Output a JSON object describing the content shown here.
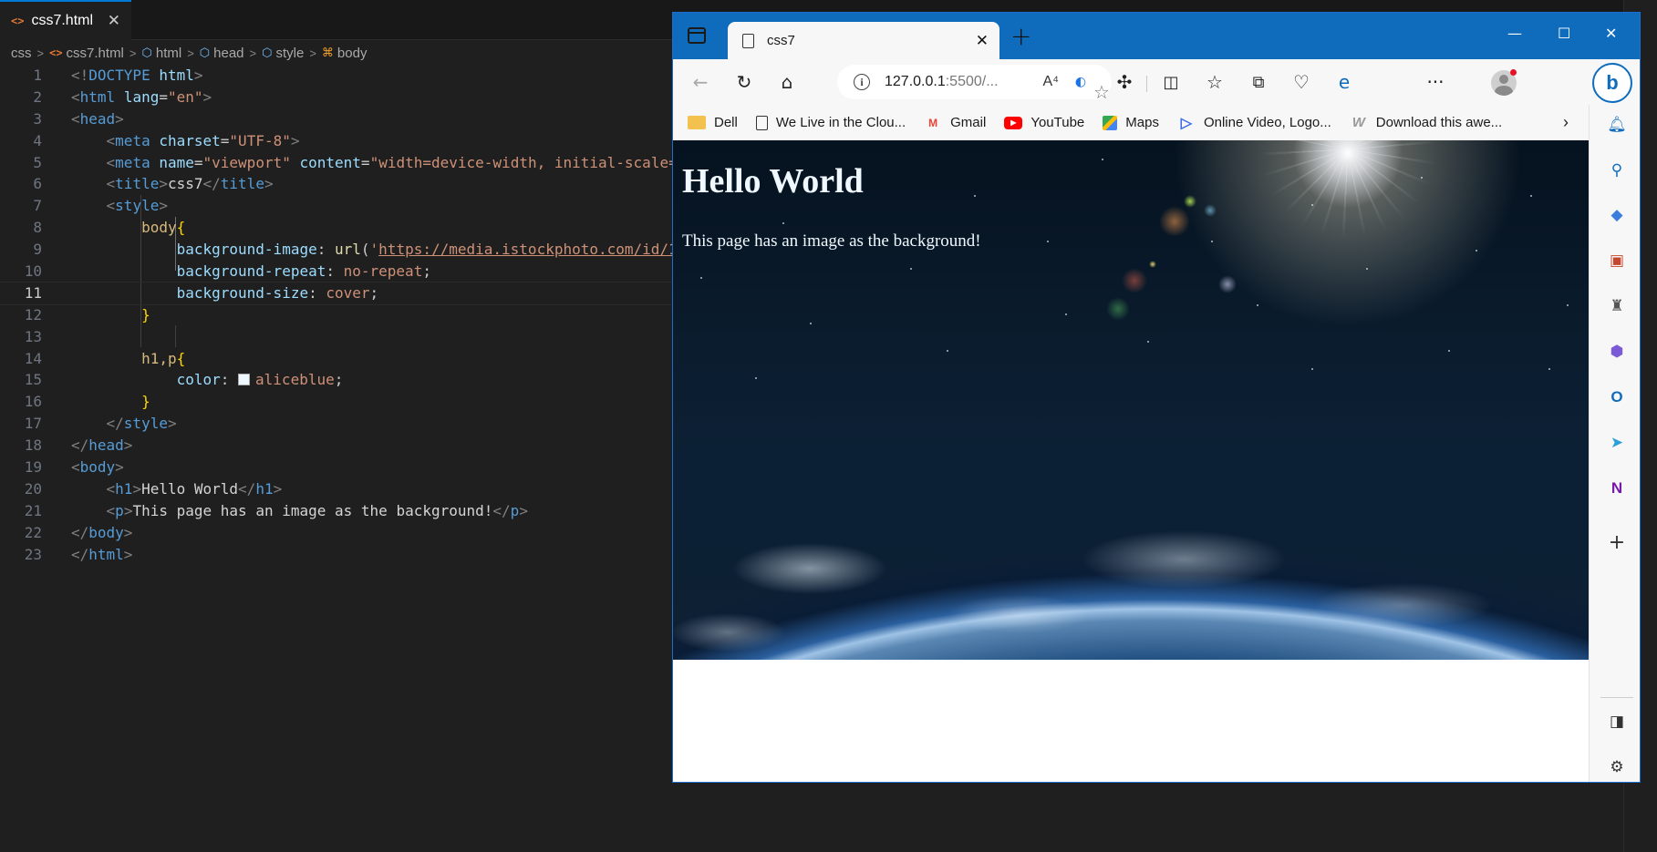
{
  "editor": {
    "tab": {
      "title": "css7.html",
      "close": "✕"
    },
    "breadcrumb": [
      "css",
      "css7.html",
      "html",
      "head",
      "style",
      "body"
    ],
    "active_line": 11,
    "lines": [
      {
        "n": "1",
        "html": "<span class='t-br'>&lt;!</span><span class='t-tag'>DOCTYPE</span> <span class='t-attr'>html</span><span class='t-br'>&gt;</span>"
      },
      {
        "n": "2",
        "html": "<span class='t-br'>&lt;</span><span class='t-tag'>html</span> <span class='t-attr'>lang</span>=<span class='t-str'>\"en\"</span><span class='t-br'>&gt;</span>"
      },
      {
        "n": "3",
        "html": "<span class='t-br'>&lt;</span><span class='t-tag'>head</span><span class='t-br'>&gt;</span>"
      },
      {
        "n": "4",
        "html": "    <span class='t-br'>&lt;</span><span class='t-tag'>meta</span> <span class='t-attr'>charset</span>=<span class='t-str'>\"UTF-8\"</span><span class='t-br'>&gt;</span>"
      },
      {
        "n": "5",
        "html": "    <span class='t-br'>&lt;</span><span class='t-tag'>meta</span> <span class='t-attr'>name</span>=<span class='t-str'>\"viewport\"</span> <span class='t-attr'>content</span>=<span class='t-str'>\"width=device-width, initial-scale=</span>"
      },
      {
        "n": "6",
        "html": "    <span class='t-br'>&lt;</span><span class='t-tag'>title</span><span class='t-br'>&gt;</span><span class='t-txt'>css7</span><span class='t-br'>&lt;/</span><span class='t-tag'>title</span><span class='t-br'>&gt;</span>"
      },
      {
        "n": "7",
        "html": "    <span class='t-br'>&lt;</span><span class='t-tag'>style</span><span class='t-br'>&gt;</span>"
      },
      {
        "n": "8",
        "html": "        <span class='t-sel'>body</span><span class='t-brace'>{</span>"
      },
      {
        "n": "9",
        "html": "            <span class='t-prop'>background-image</span>: <span class='t-fn'>url</span>(<span class='t-str'>'</span><span class='t-url'>https://media.istockphoto.com/id/1</span>"
      },
      {
        "n": "10",
        "html": "            <span class='t-prop'>background-repeat</span>: <span class='t-val'>no-repeat</span>;"
      },
      {
        "n": "11",
        "html": "            <span class='t-prop'>background-size</span>: <span class='t-val'>cover</span>;"
      },
      {
        "n": "12",
        "html": "        <span class='t-brace'>}</span>"
      },
      {
        "n": "13",
        "html": ""
      },
      {
        "n": "14",
        "html": "        <span class='t-sel'>h1,p</span><span class='t-brace'>{</span>"
      },
      {
        "n": "15",
        "html": "            <span class='t-prop'>color</span>: <span class='swatch'></span><span class='t-val'>aliceblue</span>;"
      },
      {
        "n": "16",
        "html": "        <span class='t-brace'>}</span>"
      },
      {
        "n": "17",
        "html": "    <span class='t-br'>&lt;/</span><span class='t-tag'>style</span><span class='t-br'>&gt;</span>"
      },
      {
        "n": "18",
        "html": "<span class='t-br'>&lt;/</span><span class='t-tag'>head</span><span class='t-br'>&gt;</span>"
      },
      {
        "n": "19",
        "html": "<span class='t-br'>&lt;</span><span class='t-tag'>body</span><span class='t-br'>&gt;</span>"
      },
      {
        "n": "20",
        "html": "    <span class='t-br'>&lt;</span><span class='t-tag'>h1</span><span class='t-br'>&gt;</span><span class='t-txt'>Hello World</span><span class='t-br'>&lt;/</span><span class='t-tag'>h1</span><span class='t-br'>&gt;</span>"
      },
      {
        "n": "21",
        "html": "    <span class='t-br'>&lt;</span><span class='t-tag'>p</span><span class='t-br'>&gt;</span><span class='t-txt'>This page has an image as the background!</span><span class='t-br'>&lt;/</span><span class='t-tag'>p</span><span class='t-br'>&gt;</span>"
      },
      {
        "n": "22",
        "html": "<span class='t-br'>&lt;/</span><span class='t-tag'>body</span><span class='t-br'>&gt;</span>"
      },
      {
        "n": "23",
        "html": "<span class='t-br'>&lt;/</span><span class='t-tag'>html</span><span class='t-br'>&gt;</span>"
      }
    ]
  },
  "browser": {
    "tab_title": "css7",
    "tab_close": "✕",
    "new_tab": "+",
    "window_controls": {
      "minimize": "—",
      "maximize": "☐",
      "close": "✕"
    },
    "address": {
      "host": "127.0.0.1",
      "rest": ":5500/...",
      "read_aloud": "A⁴",
      "favorite": "☆"
    },
    "favorites": [
      {
        "label": "Dell",
        "icon": "folder-icon"
      },
      {
        "label": "We Live in the Clou...",
        "icon": "page-icon"
      },
      {
        "label": "Gmail",
        "icon": "gmail-icon"
      },
      {
        "label": "YouTube",
        "icon": "youtube-icon"
      },
      {
        "label": "Maps",
        "icon": "maps-icon"
      },
      {
        "label": "Online Video, Logo...",
        "icon": "play-icon"
      },
      {
        "label": "Download this awe...",
        "icon": "w-icon"
      }
    ],
    "favorites_more": "›",
    "copilot": "b",
    "page": {
      "h1": "Hello World",
      "p": "This page has an image as the background!",
      "text_color": "#f0f8ff"
    }
  },
  "colors": {
    "accent": "#0078d4",
    "edge_blue": "#0f6cbd"
  }
}
